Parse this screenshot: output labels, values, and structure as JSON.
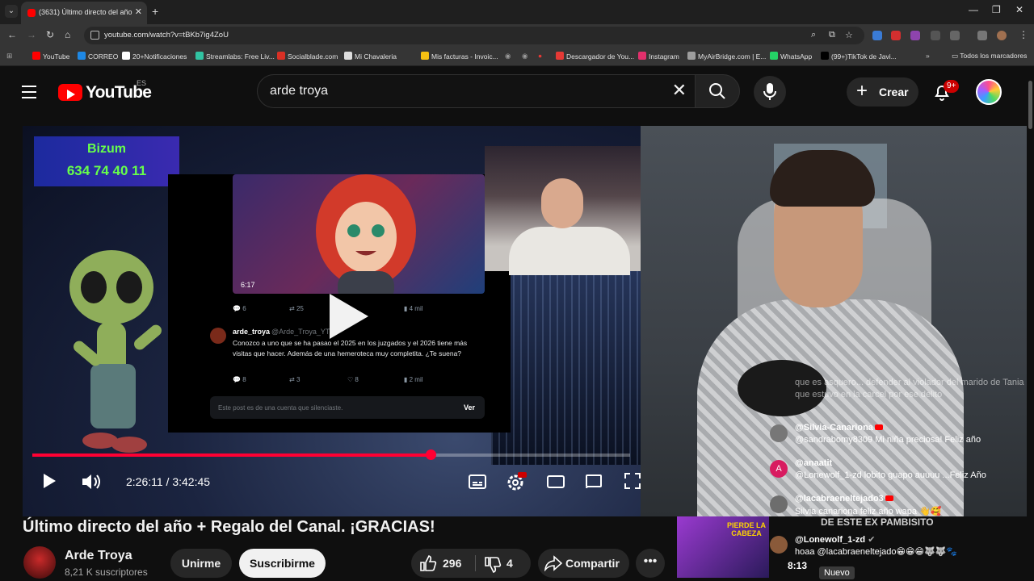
{
  "browser": {
    "tab_title": "(3631) Último directo del año",
    "url": "youtube.com/watch?v=tBKb7ig4ZoU",
    "bookmarks": [
      {
        "label": "YouTube",
        "color": "#ff0000"
      },
      {
        "label": "CORREO",
        "color": "#1e88e5"
      },
      {
        "label": "20+Notificaciones",
        "color": "#ffffff"
      },
      {
        "label": "Streamlabs: Free Liv...",
        "color": "#31c3a2"
      },
      {
        "label": "Socialblade.com",
        "color": "#d93025"
      },
      {
        "label": "Mi Chavaleria",
        "color": "#dddddd"
      },
      {
        "label": "Mis facturas - Invoic...",
        "color": "#f6c012"
      },
      {
        "label": "Descargador de You...",
        "color": "#e53935"
      },
      {
        "label": "Instagram",
        "color": "#e1306c"
      },
      {
        "label": "MyAirBridge.com | E...",
        "color": "#9e9e9e"
      },
      {
        "label": "WhatsApp",
        "color": "#25d366"
      },
      {
        "label": "(99+)TikTok de Javi...",
        "color": "#000000"
      }
    ],
    "all_bookmarks": "Todos los marcadores"
  },
  "youtube": {
    "logo_text": "YouTube",
    "country_code": "ES",
    "search_query": "arde troya",
    "create_label": "Crear",
    "notifications_badge": "9+"
  },
  "player": {
    "bizum_title": "Bizum",
    "bizum_phone": "634 74 40 11",
    "tweet": {
      "video_duration": "6:17",
      "stat_replies_top": "6",
      "stat_retweets_top": "25",
      "stat_views_top": "4 mil",
      "user": "arde_troya",
      "handle": "@Arde_Troya_YT",
      "body": "Conozco a uno que se ha pasao el 2025 en los juzgados y el 2026 tiene más visitas que hacer. Además de una hemeroteca muy completita. ¿Te suena?",
      "stat_replies": "8",
      "stat_retweets": "3",
      "stat_likes": "8",
      "stat_views": "2 mil",
      "blocked_text": "Este post es de una cuenta que silenciaste.",
      "blocked_action": "Ver"
    },
    "chat_faded": "que es asquero... defender al violador del marido de Tania que estuvo en la carcel por ese delito",
    "chat": [
      {
        "name": "@Silvia-Canariona",
        "message": "@sandrabomy8309 Mi niña preciosa! Feliz año",
        "avatar_color": "#777777",
        "avatar_letter": ""
      },
      {
        "name": "@anaatit",
        "message": "@Lonewolf_1-zd lobito guapo auuuu ...Feliz Año",
        "avatar_color": "#d81b60",
        "avatar_letter": "A"
      },
      {
        "name": "@lacabraeneltejado3",
        "message": "Silvia canariona feliz año wapa 👋🥰",
        "avatar_color": "#6d6d6d",
        "avatar_letter": ""
      },
      {
        "name": "@Lonewolf_1-zd",
        "message": "hoaa @lacabraeneltejado😁😁😁🐺🐺🐾",
        "avatar_color": "#8a5a3a",
        "avatar_letter": ""
      }
    ],
    "clip_overlay_text": "PIERDE LA CABEZA",
    "clip_banner": "DE ESTE EX PAMBISITO",
    "clip_time": "8:13",
    "new_badge": "Nuevo",
    "progress_fraction": 0.6659,
    "time_display": "2:26:11 / 3:42:45"
  },
  "video": {
    "title": "Último directo del año + Regalo del Canal. ¡GRACIAS!",
    "channel_name": "Arde Troya",
    "subscribers": "8,21 K suscriptores",
    "join_label": "Unirme",
    "subscribe_label": "Suscribirme",
    "likes": "296",
    "dislikes": "4",
    "share_label": "Compartir"
  }
}
